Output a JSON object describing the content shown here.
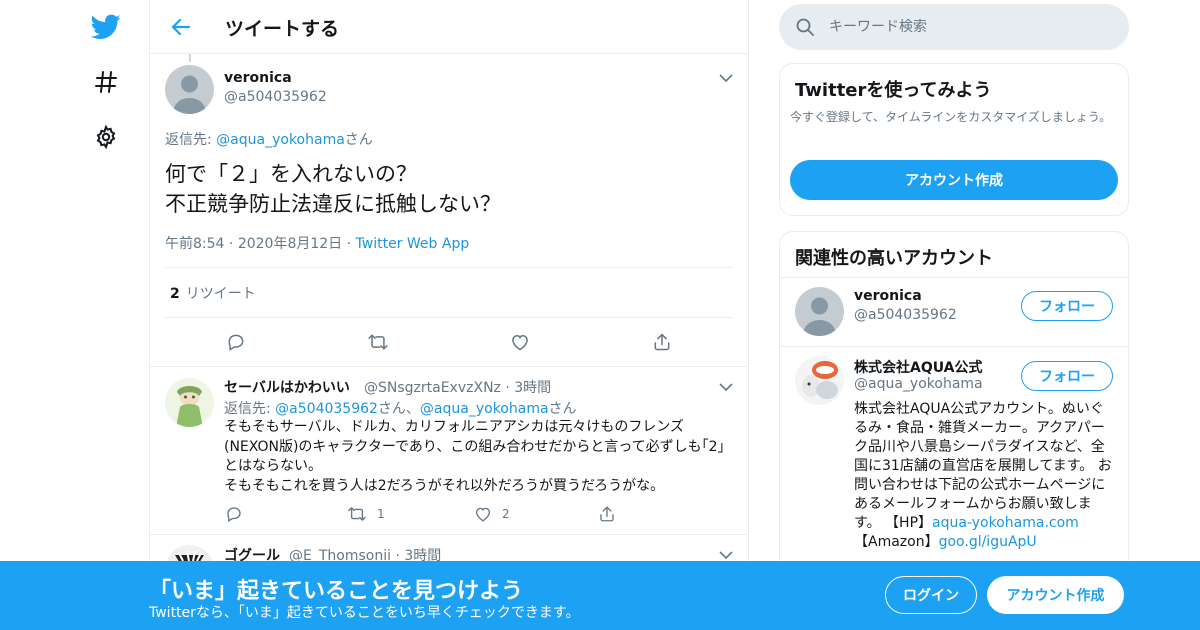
{
  "colors": {
    "accent": "#1da1f2",
    "link": "#1b95e0",
    "muted": "#657786",
    "text": "#14171a",
    "border": "#e6ecf0"
  },
  "nav": {
    "icons": [
      "twitter-bird-icon",
      "hashtag-icon",
      "gear-icon"
    ]
  },
  "header": {
    "title": "ツイートする"
  },
  "focus_tweet": {
    "name": "veronica",
    "handle": "@a504035962",
    "reply_label": "返信先: ",
    "reply_target": "@aqua_yokohama",
    "reply_suffix": "さん",
    "text": "何で「２」を入れないの？\n不正競争防止法違反に抵触しない？",
    "time": "午前8:54",
    "date": "2020年8月12日",
    "source": "Twitter Web App",
    "retweet_count": "2",
    "retweet_label": "リツイート"
  },
  "replies": [
    {
      "name": "セーバルはかわいい",
      "handle": "@SNsgzrtaExvzXNz",
      "time": "3時間",
      "reply_label": "返信先: ",
      "reply_target1": "@a504035962",
      "reply_mid": "さん、",
      "reply_target2": "@aqua_yokohama",
      "reply_suffix": "さん",
      "text": "そもそもサーバル、ドルカ、カリフォルニアアシカは元々けものフレンズ(NEXON版)のキャラクターであり、この組み合わせだからと言って必ずしも｢2｣とはならない。\nそもそもこれを買う人は2だろうがそれ以外だろうが買うだろうがな。",
      "retweets": "1",
      "likes": "2"
    },
    {
      "name": "ゴグール",
      "handle": "@E_Thomsonii",
      "time": "3時間"
    }
  ],
  "search": {
    "placeholder": "キーワード検索"
  },
  "signup_card": {
    "title": "Twitterを使ってみよう",
    "subtitle": "今すぐ登録して、タイムラインをカスタマイズしましょう。",
    "button": "アカウント作成"
  },
  "related": {
    "title": "関連性の高いアカウント",
    "accounts": [
      {
        "name": "veronica",
        "handle": "@a504035962",
        "follow": "フォロー"
      },
      {
        "name": "株式会社AQUA公式",
        "handle": "@aqua_yokohama",
        "follow": "フォロー",
        "bio": "株式会社AQUA公式アカウント。ぬいぐるみ・食品・雑貨メーカー。アクアパーク品川や八景島シーパラダイスなど、全国に31店舗の直営店を展開してます。 お問い合わせは下記の公式ホームページにあるメールフォームからお願い致します。 【HP】",
        "bio_link": "aqua-yokohama.com",
        "bio_line2": "【Amazon】",
        "bio_link2": "goo.gl/iguApU"
      }
    ]
  },
  "banner": {
    "title": "「いま」起きていることを見つけよう",
    "subtitle": "Twitterなら、「いま」起きていることをいち早くチェックできます。",
    "login": "ログイン",
    "signup": "アカウント作成"
  }
}
